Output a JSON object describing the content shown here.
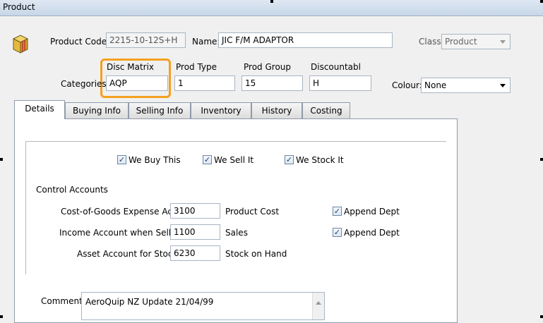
{
  "window": {
    "title": "Product"
  },
  "header": {
    "product_code_label": "Product Code:",
    "product_code_value": "2215-10-12S+H",
    "name_label": "Name:",
    "name_value": "JIC F/M ADAPTOR",
    "class_label": "Class:",
    "class_value": "Product",
    "categories_label": "Categories",
    "colour_label": "Colour:",
    "colour_value": "None",
    "categories": [
      {
        "label": "Disc Matrix",
        "value": "AQP"
      },
      {
        "label": "Prod Type",
        "value": "1"
      },
      {
        "label": "Prod Group",
        "value": "15"
      },
      {
        "label": "Discountabl",
        "value": "H"
      }
    ]
  },
  "tabs": [
    {
      "label": "Details"
    },
    {
      "label": "Buying Info"
    },
    {
      "label": "Selling Info"
    },
    {
      "label": "Inventory"
    },
    {
      "label": "History"
    },
    {
      "label": "Costing"
    }
  ],
  "details": {
    "checks": [
      {
        "label": "We Buy This",
        "checked": true
      },
      {
        "label": "We Sell It",
        "checked": true
      },
      {
        "label": "We Stock It",
        "checked": true
      }
    ],
    "control_accounts_label": "Control Accounts",
    "accounts": [
      {
        "label": "Cost-of-Goods Expense Acct:",
        "value": "3100",
        "desc": "Product Cost",
        "append_label": "Append Dept",
        "append_checked": true
      },
      {
        "label": "Income Account when Selling:",
        "value": "1100",
        "desc": "Sales",
        "append_label": "Append Dept",
        "append_checked": true
      },
      {
        "label": "Asset Account for Stock:",
        "value": "6230",
        "desc": "Stock on Hand"
      }
    ],
    "comment_label": "Comment:",
    "comment_value": "AeroQuip NZ Update 21/04/99"
  }
}
